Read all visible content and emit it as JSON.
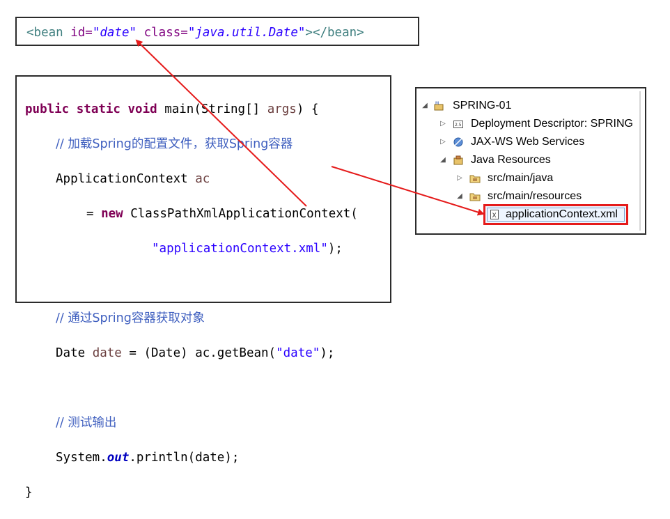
{
  "xml_snippet": {
    "open_tag": "<bean",
    "id_attr": "id=",
    "id_value": "\"date\"",
    "class_attr": "class=",
    "class_value": "\"java.util.Date\"",
    "close": "></bean>"
  },
  "java_code": {
    "l1_kw": "public static void",
    "l1_rest": " main(String[] ",
    "l1_args": "args",
    "l1_end": ") {",
    "l2_comment": "// 加载Spring的配置文件，获取Spring容器",
    "l3_type": "ApplicationContext ",
    "l3_var": "ac",
    "l4_eq": "= ",
    "l4_new": "new",
    "l4_rest": " ClassPathXmlApplicationContext(",
    "l5_str": "\"applicationContext.xml\"",
    "l5_end": ");",
    "l7_comment": "// 通过Spring容器获取对象",
    "l8_type": "Date ",
    "l8_var": "date",
    "l8_mid": " = (Date) ac.getBean(",
    "l8_str": "\"date\"",
    "l8_end": ");",
    "l10_comment": "// 测试输出",
    "l11_a": "System.",
    "l11_field": "out",
    "l11_b": ".println(date);",
    "l12": "}"
  },
  "project_tree": {
    "project": "SPRING-01",
    "deployment_descriptor": "Deployment Descriptor: SPRING",
    "jaxws": "JAX-WS Web Services",
    "java_resources": "Java Resources",
    "src_main_java": "src/main/java",
    "src_main_resources": "src/main/resources",
    "selected_file": "applicationContext.xml"
  },
  "colors": {
    "annotation_arrow": "#e51b1b",
    "keyword": "#7f0055",
    "string": "#2a00ff",
    "comment": "#3f5fbf"
  }
}
